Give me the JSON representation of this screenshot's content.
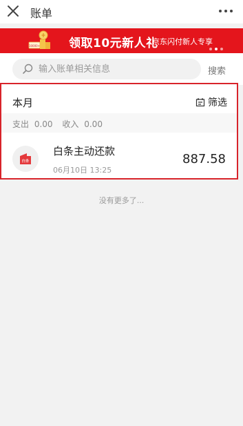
{
  "header": {
    "title": "账单",
    "close_icon": "close-icon",
    "more_icon": "more-icon"
  },
  "banner": {
    "headline": "领取10元新人礼",
    "subtext": "京东闪付新人专享",
    "gift_badge": "10000+",
    "background": "#e4151c",
    "page_indicator": {
      "count": 3,
      "active": 2
    }
  },
  "search": {
    "placeholder": "输入账单相关信息",
    "value": "",
    "button_label": "搜索"
  },
  "bill": {
    "period_label": "本月",
    "filter_label": "筛选",
    "expense_label": "支出",
    "expense_value": "0.00",
    "income_label": "收入",
    "income_value": "0.00",
    "transactions": [
      {
        "name": "白条主动还款",
        "time": "06月10日 13:25",
        "amount": "887.58",
        "icon_label": "白条"
      }
    ]
  },
  "footer": {
    "no_more": "没有更多了..."
  },
  "colors": {
    "accent_red": "#d8232a",
    "background": "#f2f2f2"
  }
}
